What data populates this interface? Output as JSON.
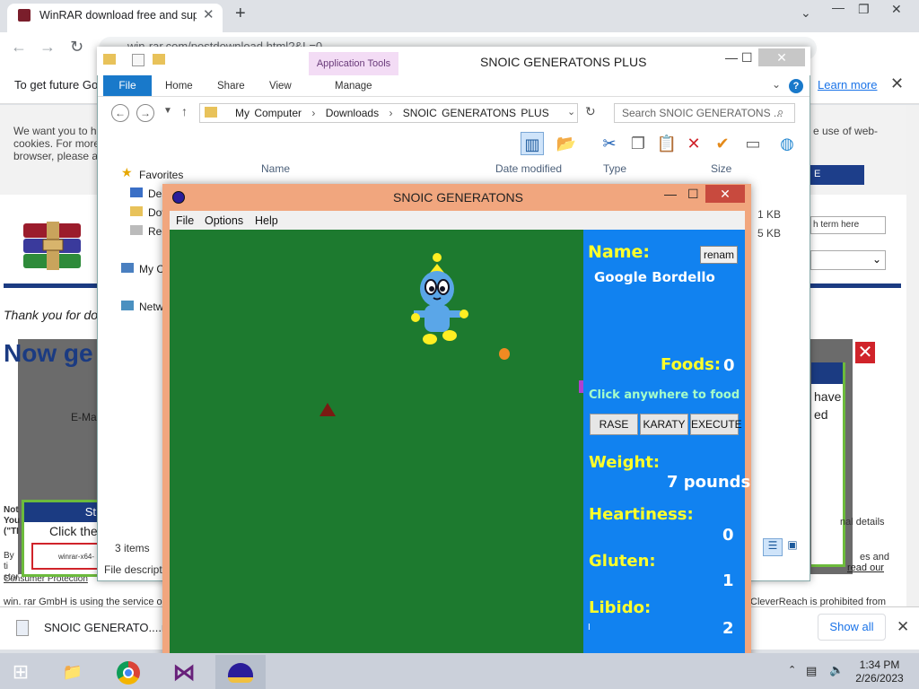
{
  "browser": {
    "tab_title": "WinRAR download free and supp",
    "url": "win-rar.com/postdownload.html?&L=0",
    "cookie_text": "To get future Go",
    "learn_more": "Learn more"
  },
  "page": {
    "consent_left": "We want you to h cookies. For more browser, please a",
    "consent_right": "e use of web-",
    "search_placeholder": "h term here",
    "button_label": "E",
    "thank_you": "Thank you for do",
    "now_get": "Now ge",
    "email_label": "E-Ma",
    "have_text": "have ed",
    "note_left": "Not You (\"TI",
    "note_right": "nal details",
    "note_right2": "es and",
    "consumer_link": "read our",
    "by_text": "By ti stor",
    "consumer_protection": "Consumer Protection",
    "popup_head": "St",
    "click_the": "Click the",
    "winrar_file": "winrar-x64-",
    "footer_left": "win. rar GmbH is using the service o",
    "footer_right": "CleverReach is prohibited from"
  },
  "download_bar": {
    "file_name": "SNOIC GENERATO....rar",
    "show_all": "Show all"
  },
  "explorer": {
    "title": "SNOIC GENERATONS PLUS",
    "app_tools": "Application Tools",
    "tabs": [
      "File",
      "Home",
      "Share",
      "View",
      "Manage"
    ],
    "address": [
      "My Computer",
      "Downloads",
      "SNOIC GENERATONS PLUS"
    ],
    "search_placeholder": "Search SNOIC GENERATONS ...",
    "columns": [
      "Name",
      "Date modified",
      "Type",
      "Size"
    ],
    "nav": [
      "Favorites",
      "Des",
      "Dov",
      "Rec",
      "My C",
      "Netw"
    ],
    "sizes": [
      "1 KB",
      "5 KB"
    ],
    "status": "3 items",
    "file_description": "File descripti"
  },
  "snoic": {
    "title": "SNOIC GENERATONS",
    "menu": [
      "File",
      "Options",
      "Help"
    ],
    "name_label": "Name:",
    "rename_button": "renam",
    "pet_name": "Google Bordello",
    "foods_label": "Foods:",
    "foods_value": "0",
    "hint": "Click anywhere to food",
    "buttons": [
      "RASE",
      "KARATY",
      "EXECUTE"
    ],
    "weight_label": "Weight:",
    "weight_value": "7 pounds",
    "heartiness_label": "Heartiness:",
    "heartiness_value": "0",
    "gluten_label": "Gluten:",
    "gluten_value": "1",
    "libido_label": "Libido:",
    "libido_value": "2",
    "libido_mark": "I",
    "colors": {
      "field": "#1d7a2f",
      "panel": "#1182f0",
      "label": "#ffff2a",
      "hint": "#a6ffc8"
    }
  },
  "taskbar": {
    "time": "1:34 PM",
    "date": "2/26/2023"
  }
}
